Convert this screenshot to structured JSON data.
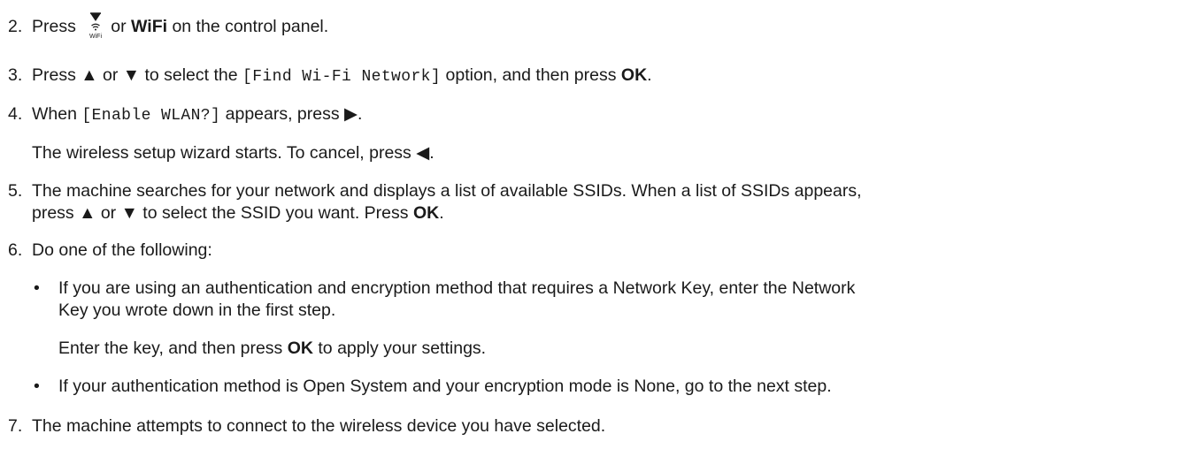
{
  "steps": [
    {
      "number": "2.",
      "parts": {
        "a": "Press",
        "b": "or",
        "c": "WiFi",
        "d": "on the control panel."
      },
      "icon": {
        "name": "wifi-button-icon",
        "label": "WiFi"
      }
    },
    {
      "number": "3.",
      "parts": {
        "a": "Press ▲ or ▼ to select the",
        "b": "[Find Wi-Fi Network]",
        "c": "option, and then press",
        "d": "OK",
        "e": "."
      }
    },
    {
      "number": "4.",
      "parts": {
        "a": "When",
        "b": "[Enable WLAN?]",
        "c": "appears, press ▶."
      },
      "note": "The wireless setup wizard starts. To cancel, press ◀."
    },
    {
      "number": "5.",
      "line1": "The machine searches for your network and displays a list of available SSIDs. When a list of SSIDs appears,",
      "line2": {
        "a": "press ▲ or ▼ to select the SSID you want. Press",
        "b": "OK",
        "c": "."
      }
    },
    {
      "number": "6.",
      "text": "Do one of the following:",
      "bullets": [
        {
          "line1": "If you are using an authentication and encryption method that requires a Network Key, enter the Network",
          "line2": "Key you wrote down in the first step.",
          "note": {
            "a": "Enter the key, and then press",
            "b": "OK",
            "c": "to apply your settings."
          }
        },
        {
          "line1": "If your authentication method is Open System and your encryption mode is None, go to the next step."
        }
      ]
    },
    {
      "number": "7.",
      "text": "The machine attempts to connect to the wireless device you have selected."
    }
  ],
  "bullet_char": "•"
}
